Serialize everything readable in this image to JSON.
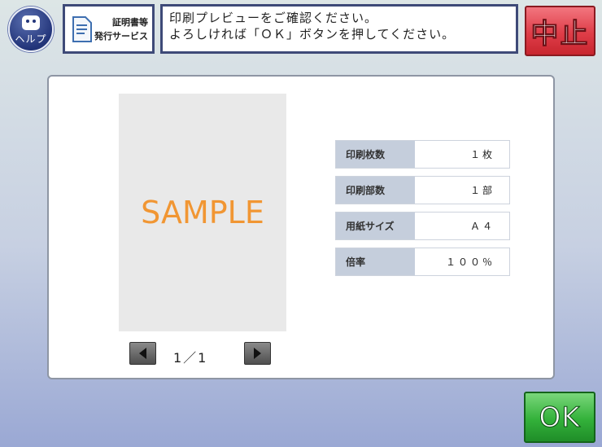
{
  "header": {
    "help_label": "ヘルプ",
    "service_line1": "証明書等",
    "service_line2": "発行サービス",
    "message_line1": "印刷プレビューをご確認ください。",
    "message_line2": "よろしければ「ＯＫ」ボタンを押してください。",
    "cancel_label": "中止"
  },
  "preview": {
    "sample_text": "SAMPLE",
    "page_indicator": "1／1"
  },
  "settings": [
    {
      "label": "印刷枚数",
      "value": "１枚"
    },
    {
      "label": "印刷部数",
      "value": "１部"
    },
    {
      "label": "用紙サイズ",
      "value": "Ａ４"
    },
    {
      "label": "倍率",
      "value": "１００％"
    }
  ],
  "footer": {
    "ok_label": "OK"
  }
}
